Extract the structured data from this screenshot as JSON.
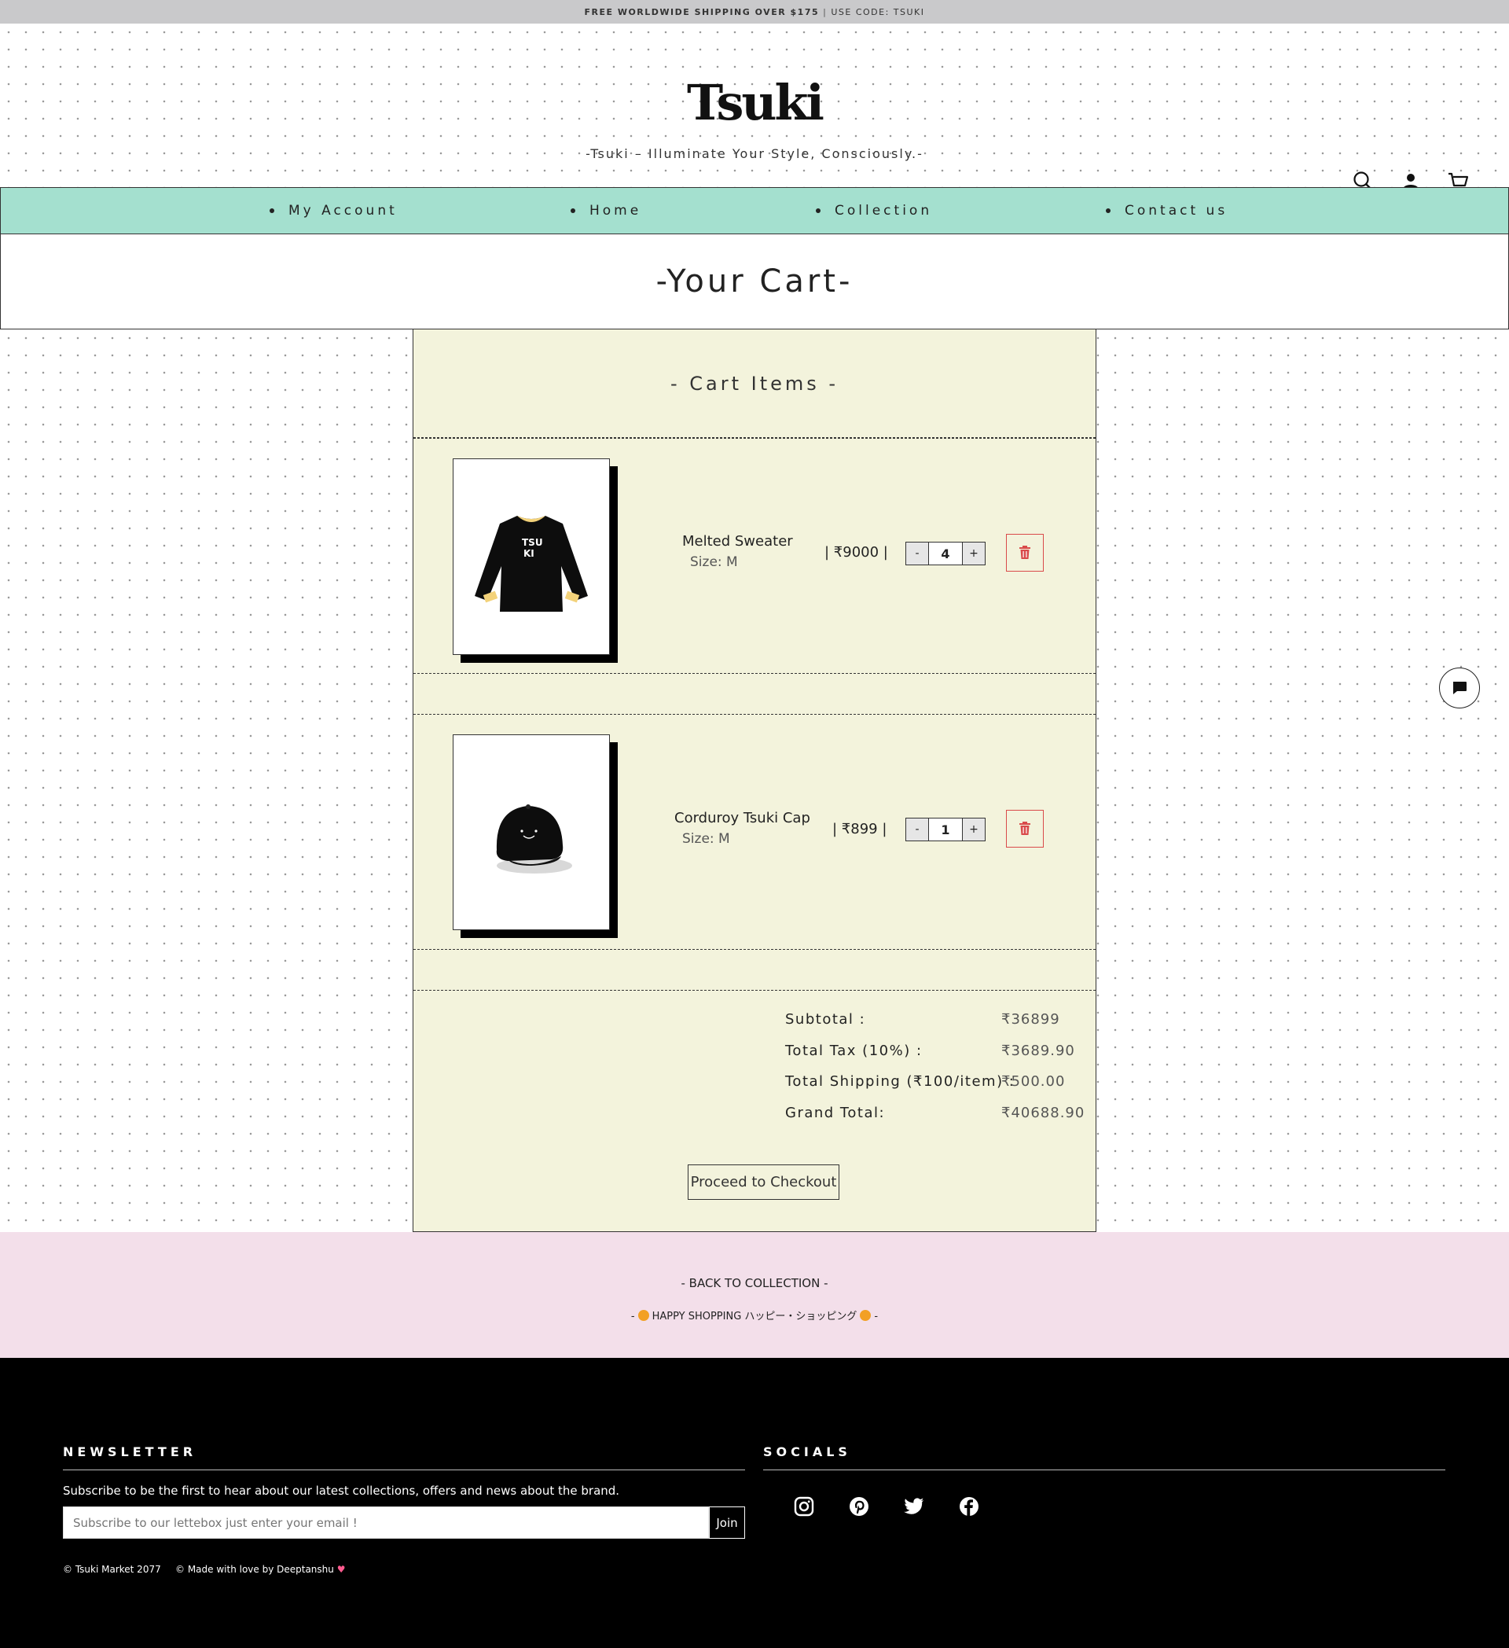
{
  "announcement": {
    "bold": "FREE WORLDWIDE SHIPPING OVER $175",
    "separator": "|",
    "code": "USE CODE: TSUKI"
  },
  "brand": {
    "logo": "Tsuki",
    "tagline": "-Tsuki – Illuminate Your Style, Consciously.-"
  },
  "header_icons": [
    "search-icon",
    "user-icon",
    "cart-icon"
  ],
  "nav": {
    "items": [
      {
        "label": "My Account"
      },
      {
        "label": "Home"
      },
      {
        "label": "Collection"
      },
      {
        "label": "Contact us"
      }
    ]
  },
  "page_title": "-Your Cart-",
  "cart": {
    "heading": "- Cart Items -",
    "items": [
      {
        "name": "Melted Sweater",
        "size": "Size: M",
        "price": "| ₹9000 |",
        "qty": "4",
        "minus": "-",
        "plus": "+",
        "image": "black-sweater"
      },
      {
        "name": "Corduroy Tsuki Cap",
        "size": "Size: M",
        "price": "| ₹899 |",
        "qty": "1",
        "minus": "-",
        "plus": "+",
        "image": "black-cap"
      }
    ],
    "summary": [
      {
        "label": "Subtotal :",
        "value": "₹36899"
      },
      {
        "label": "Total Tax (10%) :",
        "value": "₹3689.90"
      },
      {
        "label": "Total Shipping (₹100/item) :",
        "value": "₹500.00"
      },
      {
        "label": "Grand Total:",
        "value": "₹40688.90"
      }
    ],
    "checkout_label": "Proceed to Checkout"
  },
  "band": {
    "back_label": "- BACK TO COLLECTION -",
    "happy_prefix": "-",
    "happy_text": "HAPPY SHOPPING ハッピー・ショッピング",
    "happy_suffix": "-"
  },
  "footer": {
    "newsletter_heading": "NEWSLETTER",
    "newsletter_desc": "Subscribe to be the first to hear about our latest collections, offers and news about the brand.",
    "email_placeholder": "Subscribe to our lettebox just enter your email !",
    "join_label": "Join",
    "copyright": "© Tsuki Market 2077",
    "made_with": "© Made with love by Deeptanshu",
    "socials_heading": "SOCIALS",
    "socials": [
      "instagram-icon",
      "pinterest-icon",
      "twitter-icon",
      "facebook-icon"
    ]
  },
  "colors": {
    "nav_bg": "#a4e0cf",
    "cart_bg": "#f3f3dc",
    "band_bg": "#f3dfea",
    "delete_red": "#d94a4a"
  }
}
